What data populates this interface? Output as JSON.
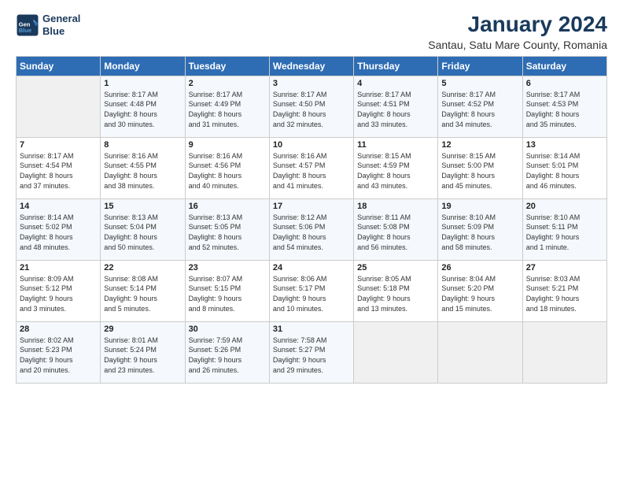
{
  "app": {
    "logo_line1": "General",
    "logo_line2": "Blue"
  },
  "header": {
    "title": "January 2024",
    "subtitle": "Santau, Satu Mare County, Romania"
  },
  "days_of_week": [
    "Sunday",
    "Monday",
    "Tuesday",
    "Wednesday",
    "Thursday",
    "Friday",
    "Saturday"
  ],
  "weeks": [
    [
      {
        "day": "",
        "content": ""
      },
      {
        "day": "1",
        "content": "Sunrise: 8:17 AM\nSunset: 4:48 PM\nDaylight: 8 hours\nand 30 minutes."
      },
      {
        "day": "2",
        "content": "Sunrise: 8:17 AM\nSunset: 4:49 PM\nDaylight: 8 hours\nand 31 minutes."
      },
      {
        "day": "3",
        "content": "Sunrise: 8:17 AM\nSunset: 4:50 PM\nDaylight: 8 hours\nand 32 minutes."
      },
      {
        "day": "4",
        "content": "Sunrise: 8:17 AM\nSunset: 4:51 PM\nDaylight: 8 hours\nand 33 minutes."
      },
      {
        "day": "5",
        "content": "Sunrise: 8:17 AM\nSunset: 4:52 PM\nDaylight: 8 hours\nand 34 minutes."
      },
      {
        "day": "6",
        "content": "Sunrise: 8:17 AM\nSunset: 4:53 PM\nDaylight: 8 hours\nand 35 minutes."
      }
    ],
    [
      {
        "day": "7",
        "content": "Sunrise: 8:17 AM\nSunset: 4:54 PM\nDaylight: 8 hours\nand 37 minutes."
      },
      {
        "day": "8",
        "content": "Sunrise: 8:16 AM\nSunset: 4:55 PM\nDaylight: 8 hours\nand 38 minutes."
      },
      {
        "day": "9",
        "content": "Sunrise: 8:16 AM\nSunset: 4:56 PM\nDaylight: 8 hours\nand 40 minutes."
      },
      {
        "day": "10",
        "content": "Sunrise: 8:16 AM\nSunset: 4:57 PM\nDaylight: 8 hours\nand 41 minutes."
      },
      {
        "day": "11",
        "content": "Sunrise: 8:15 AM\nSunset: 4:59 PM\nDaylight: 8 hours\nand 43 minutes."
      },
      {
        "day": "12",
        "content": "Sunrise: 8:15 AM\nSunset: 5:00 PM\nDaylight: 8 hours\nand 45 minutes."
      },
      {
        "day": "13",
        "content": "Sunrise: 8:14 AM\nSunset: 5:01 PM\nDaylight: 8 hours\nand 46 minutes."
      }
    ],
    [
      {
        "day": "14",
        "content": "Sunrise: 8:14 AM\nSunset: 5:02 PM\nDaylight: 8 hours\nand 48 minutes."
      },
      {
        "day": "15",
        "content": "Sunrise: 8:13 AM\nSunset: 5:04 PM\nDaylight: 8 hours\nand 50 minutes."
      },
      {
        "day": "16",
        "content": "Sunrise: 8:13 AM\nSunset: 5:05 PM\nDaylight: 8 hours\nand 52 minutes."
      },
      {
        "day": "17",
        "content": "Sunrise: 8:12 AM\nSunset: 5:06 PM\nDaylight: 8 hours\nand 54 minutes."
      },
      {
        "day": "18",
        "content": "Sunrise: 8:11 AM\nSunset: 5:08 PM\nDaylight: 8 hours\nand 56 minutes."
      },
      {
        "day": "19",
        "content": "Sunrise: 8:10 AM\nSunset: 5:09 PM\nDaylight: 8 hours\nand 58 minutes."
      },
      {
        "day": "20",
        "content": "Sunrise: 8:10 AM\nSunset: 5:11 PM\nDaylight: 9 hours\nand 1 minute."
      }
    ],
    [
      {
        "day": "21",
        "content": "Sunrise: 8:09 AM\nSunset: 5:12 PM\nDaylight: 9 hours\nand 3 minutes."
      },
      {
        "day": "22",
        "content": "Sunrise: 8:08 AM\nSunset: 5:14 PM\nDaylight: 9 hours\nand 5 minutes."
      },
      {
        "day": "23",
        "content": "Sunrise: 8:07 AM\nSunset: 5:15 PM\nDaylight: 9 hours\nand 8 minutes."
      },
      {
        "day": "24",
        "content": "Sunrise: 8:06 AM\nSunset: 5:17 PM\nDaylight: 9 hours\nand 10 minutes."
      },
      {
        "day": "25",
        "content": "Sunrise: 8:05 AM\nSunset: 5:18 PM\nDaylight: 9 hours\nand 13 minutes."
      },
      {
        "day": "26",
        "content": "Sunrise: 8:04 AM\nSunset: 5:20 PM\nDaylight: 9 hours\nand 15 minutes."
      },
      {
        "day": "27",
        "content": "Sunrise: 8:03 AM\nSunset: 5:21 PM\nDaylight: 9 hours\nand 18 minutes."
      }
    ],
    [
      {
        "day": "28",
        "content": "Sunrise: 8:02 AM\nSunset: 5:23 PM\nDaylight: 9 hours\nand 20 minutes."
      },
      {
        "day": "29",
        "content": "Sunrise: 8:01 AM\nSunset: 5:24 PM\nDaylight: 9 hours\nand 23 minutes."
      },
      {
        "day": "30",
        "content": "Sunrise: 7:59 AM\nSunset: 5:26 PM\nDaylight: 9 hours\nand 26 minutes."
      },
      {
        "day": "31",
        "content": "Sunrise: 7:58 AM\nSunset: 5:27 PM\nDaylight: 9 hours\nand 29 minutes."
      },
      {
        "day": "",
        "content": ""
      },
      {
        "day": "",
        "content": ""
      },
      {
        "day": "",
        "content": ""
      }
    ]
  ]
}
